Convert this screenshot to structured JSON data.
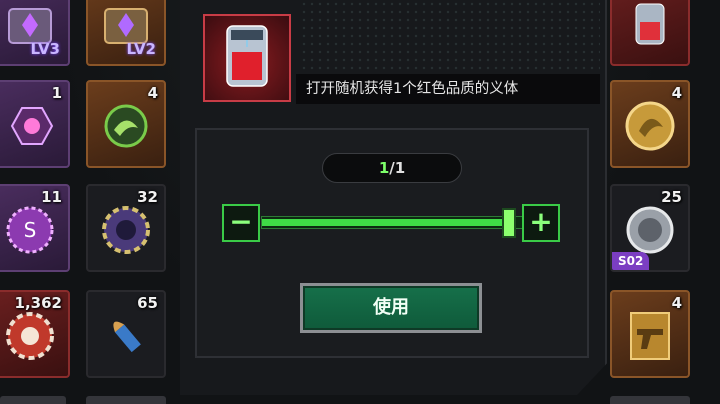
{
  "left_grid": [
    {
      "count": "",
      "tag": "LV3",
      "color": "purple",
      "icon": "chest-icon"
    },
    {
      "count": "",
      "tag": "LV2",
      "color": "orange",
      "icon": "chest-icon"
    },
    {
      "count": "1",
      "tag": "",
      "color": "purple",
      "icon": "cyber-implant-icon"
    },
    {
      "count": "4",
      "tag": "",
      "color": "orange",
      "icon": "dragon-emblem-icon"
    },
    {
      "count": "11",
      "tag": "",
      "color": "purple",
      "icon": "bottle-cap-icon"
    },
    {
      "count": "32",
      "tag": "",
      "color": "dark",
      "icon": "poker-chip-icon"
    },
    {
      "count": "1,362",
      "tag": "",
      "color": "red",
      "icon": "red-chip-icon"
    },
    {
      "count": "65",
      "tag": "",
      "color": "dark",
      "icon": "bullet-icon"
    }
  ],
  "right_grid": [
    {
      "count": "",
      "season": "",
      "color": "red",
      "icon": "red-capsule-icon"
    },
    {
      "count": "4",
      "season": "",
      "color": "orange",
      "icon": "gold-dragon-coin-icon"
    },
    {
      "count": "25",
      "season": "S02",
      "color": "dark",
      "icon": "silver-coin-icon"
    },
    {
      "count": "4",
      "season": "",
      "color": "orange",
      "icon": "revolver-card-icon"
    }
  ],
  "dialog": {
    "description": "打开随机获得1个红色品质的义体",
    "quantity_current": "1",
    "quantity_sep_total": "/1",
    "minus_label": "−",
    "plus_label": "+",
    "use_label": "使用",
    "slider_fraction": 1.0
  },
  "colors": {
    "accent_green": "#3fdc46",
    "rarity_red": "#c83c46",
    "rarity_purple": "#5d3f73",
    "rarity_orange": "#8a5528"
  }
}
